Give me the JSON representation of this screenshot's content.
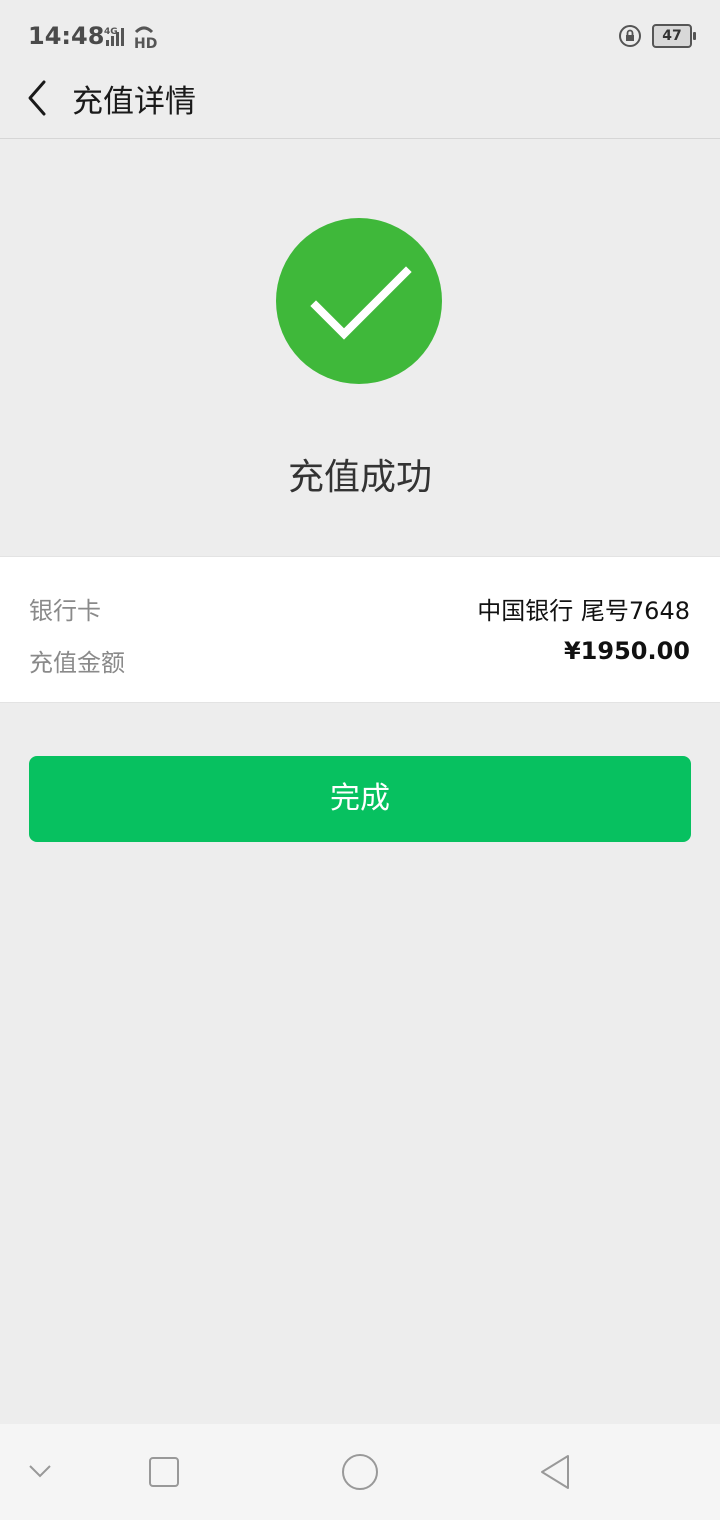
{
  "status_bar": {
    "time": "14:48",
    "battery_level": "47",
    "network": "4G",
    "hd": "HD"
  },
  "header": {
    "title": "充值详情",
    "back_icon": "chevron-left-icon"
  },
  "result": {
    "icon": "check-circle-icon",
    "icon_color": "#3fb83a",
    "text": "充值成功"
  },
  "details": {
    "rows": [
      {
        "label": "银行卡",
        "value": "中国银行 尾号7648"
      },
      {
        "label": "充值金额",
        "value": "¥1950.00"
      }
    ]
  },
  "actions": {
    "done_label": "完成",
    "button_color": "#07c160"
  },
  "navbar": {
    "icons": [
      "collapse-down-icon",
      "recent-apps-icon",
      "home-icon",
      "back-triangle-icon"
    ]
  }
}
